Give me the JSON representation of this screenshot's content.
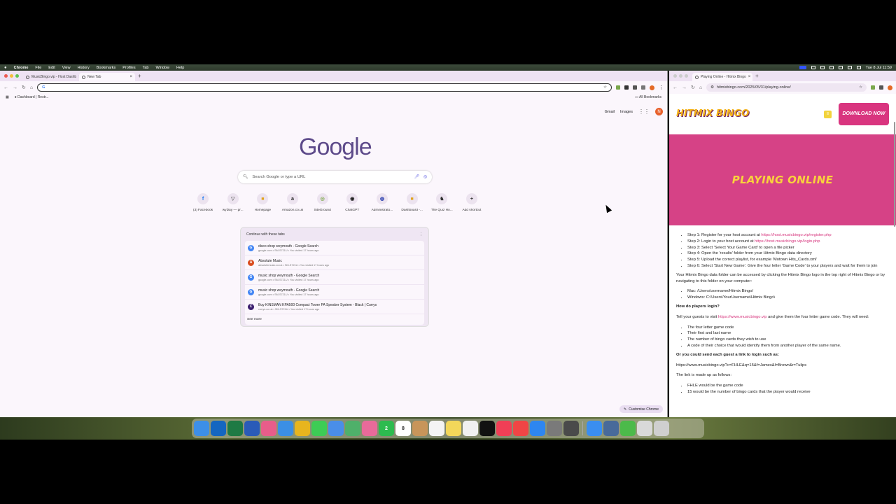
{
  "menubar": {
    "app": "Chrome",
    "items": [
      "File",
      "Edit",
      "View",
      "History",
      "Bookmarks",
      "Profiles",
      "Tab",
      "Window",
      "Help"
    ],
    "clock": "Tue 8 Jul  11:59"
  },
  "left_window": {
    "tabs": [
      {
        "title": "MusicBingo.vip - Host Dashb"
      },
      {
        "title": "New Tab"
      }
    ],
    "omnibox_value": "",
    "bookmark_item": "Dashboard | Restr...",
    "all_bookmarks": "All Bookmarks",
    "ntp": {
      "gmail": "Gmail",
      "images": "Images",
      "avatar_letter": "N",
      "logo": "Google",
      "search_placeholder": "Search Google or type a URL",
      "shortcuts": [
        {
          "label": "(3) Facebook",
          "glyph": "f",
          "color": "#1877f2"
        },
        {
          "label": "wyDay — pr...",
          "glyph": "▽",
          "color": "#777777"
        },
        {
          "label": "Homepage",
          "glyph": "■",
          "color": "#e0a31e"
        },
        {
          "label": "Amazon.co.uk",
          "glyph": "a",
          "color": "#222222"
        },
        {
          "label": "SiteGround",
          "glyph": "◎",
          "color": "#7ea84c"
        },
        {
          "label": "ChatGPT",
          "glyph": "◉",
          "color": "#222222"
        },
        {
          "label": "Administrato...",
          "glyph": "◍",
          "color": "#2a3fb0"
        },
        {
          "label": "Dashboard -...",
          "glyph": "■",
          "color": "#e0a31e"
        },
        {
          "label": "The Quiz Ho...",
          "glyph": "♞",
          "color": "#333333"
        },
        {
          "label": "Add shortcut",
          "glyph": "+",
          "color": "#333333"
        }
      ],
      "continue_title": "Continue with these tabs",
      "continue_tabs": [
        {
          "title": "disco shop weymouth - Google Search",
          "meta": "google.com • SM-S721U • You visited 17 hours ago",
          "glyph": "G",
          "color": "#4285f4"
        },
        {
          "title": "Absolute Music",
          "meta": "absolutemusic.co.uk • SM-S721U • You visited 17 hours ago",
          "glyph": "A",
          "color": "#d94b1e"
        },
        {
          "title": "music shop weymouth - Google Search",
          "meta": "google.com • SM-S721U • You visited 17 hours ago",
          "glyph": "G",
          "color": "#4285f4"
        },
        {
          "title": "music shop weymouth - Google Search",
          "meta": "google.com • SM-S721U • You visited 17 hours ago",
          "glyph": "G",
          "color": "#4285f4"
        },
        {
          "title": "Buy KINSMAN KPA500 Compact Tower PA Speaker System - Black | Currys",
          "meta": "currys.co.uk • SM-S721U • You visited 17 hours ago",
          "glyph": "C",
          "color": "#3a1d6e"
        }
      ],
      "see_more": "See more",
      "customise": "Customise Chrome"
    }
  },
  "right_window": {
    "tab_title": "Playing Online - Hitmix Bingo",
    "url": "hitmixbingo.com/2025/05/31/playing-online/",
    "site": {
      "logo": "HITMIX BINGO",
      "download": "DOWNLOAD NOW",
      "hero_title": "PLAYING ONLINE",
      "steps": [
        {
          "text": "Step 1: Register for your host account at ",
          "link": "https://host.musicbingo.vip/register.php"
        },
        {
          "text": "Step 2: Login to your host account at ",
          "link": "https://host.musicbingo.vip/login.php"
        },
        {
          "text": "Step 3: Select 'Select Your Game Card' to open a file picker",
          "link": ""
        },
        {
          "text": "Step 4: Open the 'results' folder from your Hitmix Bingo data directory",
          "link": ""
        },
        {
          "text": "Step 5: Upload the correct playlist, for example 'Motown Hits_Cards.xml'",
          "link": ""
        },
        {
          "text": "Step 6: Select 'Start New Game'. Give the four letter 'Game Code' to your players and wait for them to join",
          "link": ""
        }
      ],
      "folder_para": "Your Hitmix Bingo data folder can be accessed by clicking the Hitmix Bingo logo in the top right of Hitmix Bingo or by navigating to this folder on your computer:",
      "paths": [
        "Mac: /Users/username/Hitmix Bingo/",
        "Windows: C:\\Users\\YourUsername\\Hitmix Bingo\\"
      ],
      "login_heading": "How do players login?",
      "guests_pre": "Tell your guests to visit ",
      "guests_link": "https://www.musicbingo.vip",
      "guests_post": " and give them the four letter game code. They will need:",
      "needs": [
        "The four letter game code",
        "Their first and last name",
        "The number of bingo cards they wish to use",
        "A code of their choice that would identify them from another player of the same name."
      ],
      "link_heading": "Or you could send each guest a link to login such as:",
      "example_link": "https://www.musicbingo.vip?c=FHLE&q=15&f=James&l=Brown&r=Tulips",
      "made_up": "The link is made up as follows:",
      "parts": [
        "FHLE would be the game code",
        "15 would be the number of bingo cards that the player would receive"
      ]
    }
  },
  "dock": [
    {
      "name": "finder",
      "color": "#3d8fe8"
    },
    {
      "name": "outlook",
      "color": "#1466c0"
    },
    {
      "name": "excel",
      "color": "#1e7a44"
    },
    {
      "name": "word",
      "color": "#2a5bb8"
    },
    {
      "name": "launchpad",
      "color": "#e85d8a"
    },
    {
      "name": "safari",
      "color": "#3b8fe5"
    },
    {
      "name": "chrome",
      "color": "#e8b51e"
    },
    {
      "name": "messages",
      "color": "#3dcc55"
    },
    {
      "name": "mail",
      "color": "#4a8ee8"
    },
    {
      "name": "maps",
      "color": "#4fb06a"
    },
    {
      "name": "photos",
      "color": "#e86a9a"
    },
    {
      "name": "facetime",
      "color": "#2dbb4f"
    },
    {
      "name": "calendar",
      "color": "#ffffff"
    },
    {
      "name": "contacts",
      "color": "#c8955a"
    },
    {
      "name": "reminders",
      "color": "#f4f4f4"
    },
    {
      "name": "notes",
      "color": "#f3d75a"
    },
    {
      "name": "freeform",
      "color": "#f0f0f0"
    },
    {
      "name": "tv",
      "color": "#111111"
    },
    {
      "name": "music",
      "color": "#f03f56"
    },
    {
      "name": "news",
      "color": "#f04545"
    },
    {
      "name": "app-store",
      "color": "#2e86f0"
    },
    {
      "name": "system-settings",
      "color": "#7a7a7a"
    },
    {
      "name": "iphone-mirroring",
      "color": "#4a4a4a"
    },
    {
      "name": "home",
      "color": "#3a8ef0"
    },
    {
      "name": "screen-sharing",
      "color": "#486a9a"
    },
    {
      "name": "facetime-2",
      "color": "#4cba4a"
    },
    {
      "name": "downloads",
      "color": "#d9d9d9"
    },
    {
      "name": "trash",
      "color": "#cfcfcf"
    }
  ],
  "dock_calendar_day": "8",
  "dock_badge": "2"
}
